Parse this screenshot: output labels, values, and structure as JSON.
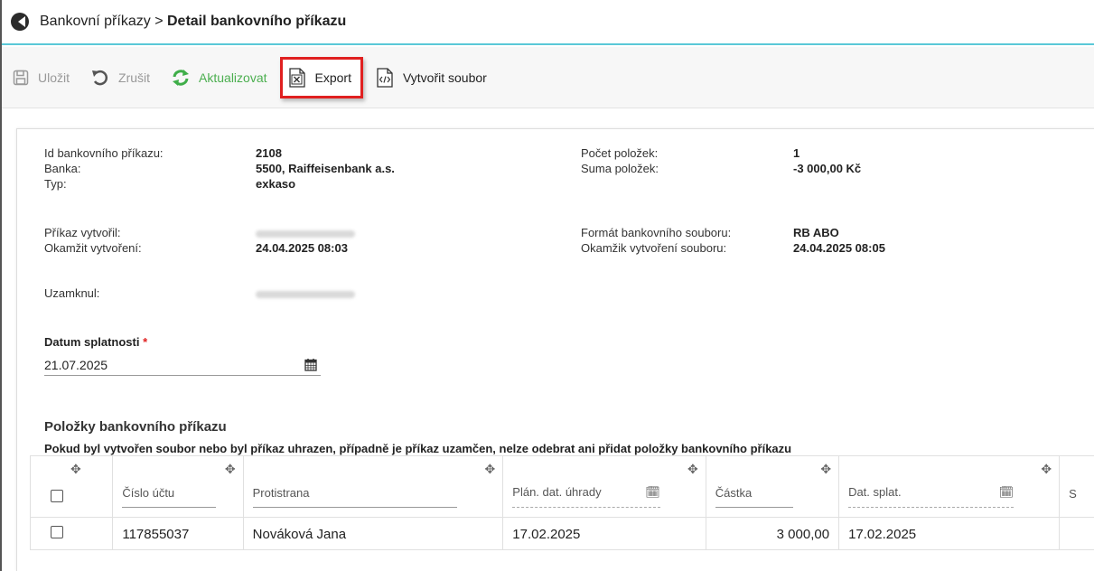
{
  "breadcrumb": {
    "parent": "Bankovní příkazy",
    "separator": ">",
    "current": "Detail bankovního příkazu"
  },
  "toolbar": {
    "save": "Uložit",
    "cancel": "Zrušit",
    "refresh": "Aktualizovat",
    "export": "Export",
    "create_file": "Vytvořit soubor"
  },
  "info": {
    "id_label": "Id bankovního příkazu:",
    "id_value": "2108",
    "bank_label": "Banka:",
    "bank_value": "5500, Raiffeisenbank a.s.",
    "type_label": "Typ:",
    "type_value": "exkaso",
    "count_label": "Počet položek:",
    "count_value": "1",
    "sum_label": "Suma položek:",
    "sum_value": "-3 000,00 Kč",
    "created_by_label": "Příkaz vytvořil:",
    "created_at_label": "Okamžit vytvoření:",
    "created_at_value": "24.04.2025 08:03",
    "file_format_label": "Formát bankovního souboru:",
    "file_format_value": "RB ABO",
    "file_created_label": "Okamžik vytvoření souboru:",
    "file_created_value": "24.04.2025 08:05",
    "locked_label": "Uzamknul:"
  },
  "due_date": {
    "label": "Datum splatnosti",
    "required_mark": "*",
    "value": "21.07.2025"
  },
  "items": {
    "title": "Položky bankovního příkazu",
    "note": "Pokud byl vytvořen soubor nebo byl příkaz uhrazen, případně je příkaz uzamčen, nelze odebrat ani přidat položky bankovního příkazu",
    "columns": {
      "account": "Číslo účtu",
      "counterparty": "Protistrana",
      "planned_date": "Plán. dat. úhrady",
      "amount": "Částka",
      "due_date": "Dat. splat.",
      "next": "S"
    },
    "rows": [
      {
        "account": "117855037",
        "counterparty": "Nováková Jana",
        "planned_date": "17.02.2025",
        "amount": "3 000,00",
        "due_date": "17.02.2025"
      }
    ]
  }
}
